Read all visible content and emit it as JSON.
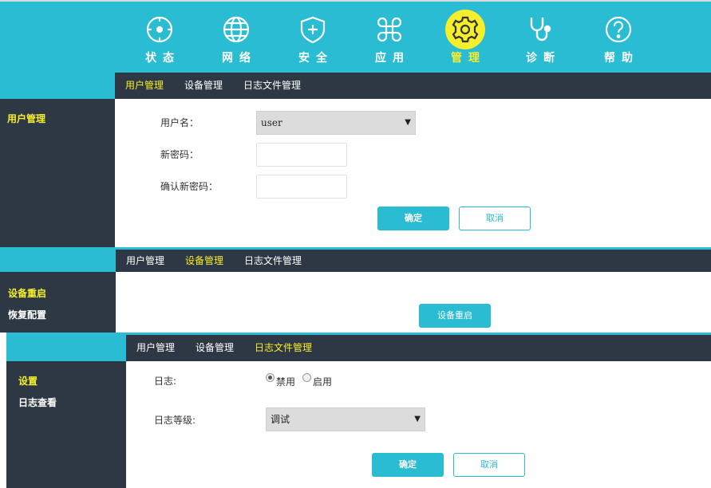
{
  "nav": {
    "items": [
      {
        "label": "状态",
        "icon": "status-icon"
      },
      {
        "label": "网络",
        "icon": "globe-icon"
      },
      {
        "label": "安全",
        "icon": "shield-icon"
      },
      {
        "label": "应用",
        "icon": "apps-icon"
      },
      {
        "label": "管理",
        "icon": "gear-icon"
      },
      {
        "label": "诊断",
        "icon": "stethoscope-icon"
      },
      {
        "label": "帮助",
        "icon": "help-icon"
      }
    ],
    "active_index": 4
  },
  "tabs": [
    "用户管理",
    "设备管理",
    "日志文件管理"
  ],
  "panel1": {
    "active_tab": 0,
    "side_items": [
      "用户管理"
    ],
    "username_label": "用户名：",
    "username_value": "user",
    "new_password_label": "新密码：",
    "confirm_password_label": "确认新密码：",
    "ok_label": "确定",
    "cancel_label": "取消"
  },
  "panel2": {
    "active_tab": 1,
    "side_items": [
      "设备重启",
      "恢复配置"
    ],
    "reboot_label": "设备重启"
  },
  "panel3": {
    "active_tab": 2,
    "side_items": [
      "设置",
      "日志查看"
    ],
    "log_label": "日志:",
    "disable_label": "禁用",
    "enable_label": "启用",
    "log_level_label": "日志等级:",
    "log_level_value": "调试",
    "ok_label": "确定",
    "cancel_label": "取消"
  },
  "colors": {
    "accent": "#29bcd3",
    "highlight": "#f5ee2c",
    "dark": "#2e3844"
  }
}
